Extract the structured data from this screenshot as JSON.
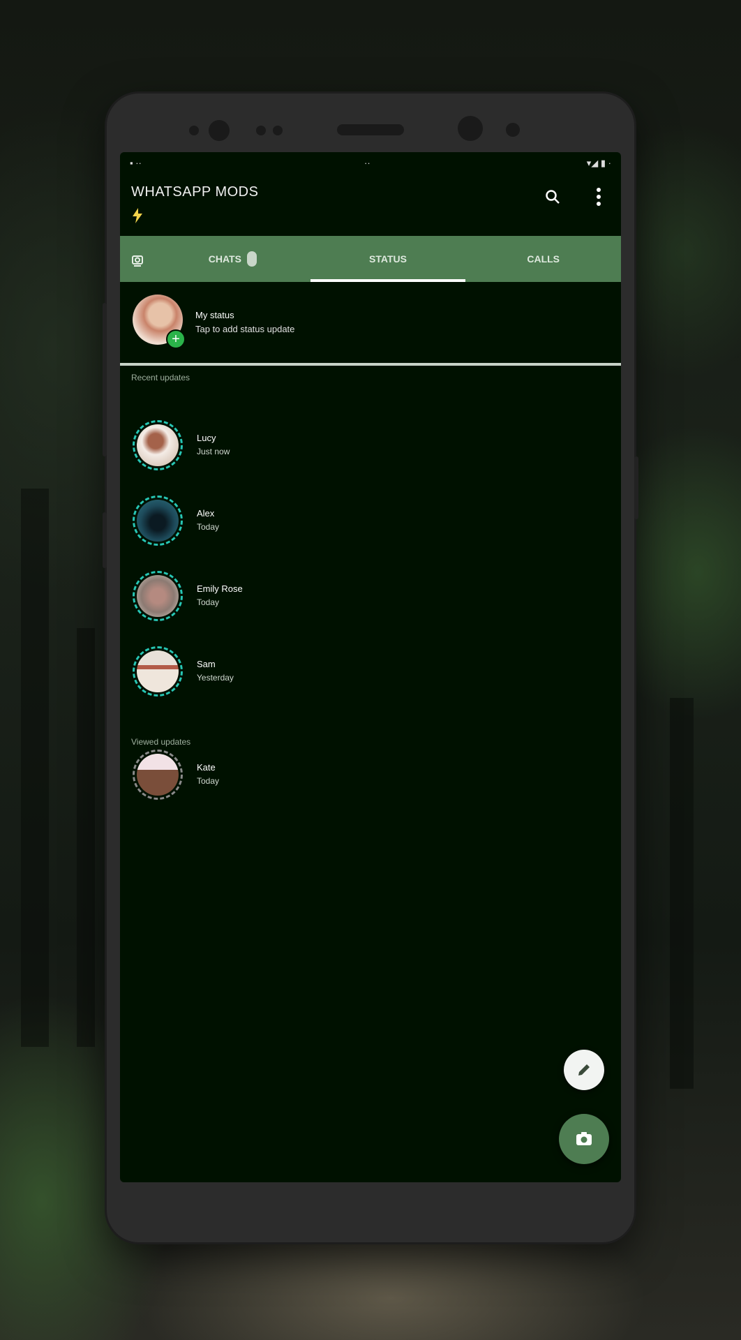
{
  "statusbar": {
    "left": "▪ ··",
    "mid": "··",
    "right": "▾◢ ▮ ·"
  },
  "app": {
    "title": "WHATSAPP MODS"
  },
  "tabs": [
    {
      "label": "CHATS",
      "active": false
    },
    {
      "label": "STATUS",
      "active": true
    },
    {
      "label": "CALLS",
      "active": false
    }
  ],
  "my_status": {
    "name": "My status",
    "hint": "Tap to add status update"
  },
  "sections": {
    "recent": "Recent updates",
    "viewed": "Viewed updates"
  },
  "statuses": [
    {
      "name": "Lucy",
      "time": "Just now",
      "seen": false
    },
    {
      "name": "Alex",
      "time": "Today",
      "seen": false
    },
    {
      "name": "Emily Rose",
      "time": "Today",
      "seen": false
    },
    {
      "name": "Sam",
      "time": "Yesterday",
      "seen": false
    },
    {
      "name": "Kate",
      "time": "Today",
      "seen": true
    }
  ],
  "icons": {
    "search": "search-icon",
    "menu": "more-vert-icon",
    "camera": "camera-icon",
    "edit": "pencil-icon"
  },
  "colors": {
    "accent": "#4e7d52",
    "screen_bg": "#001100",
    "ring": "#27c6b4"
  }
}
